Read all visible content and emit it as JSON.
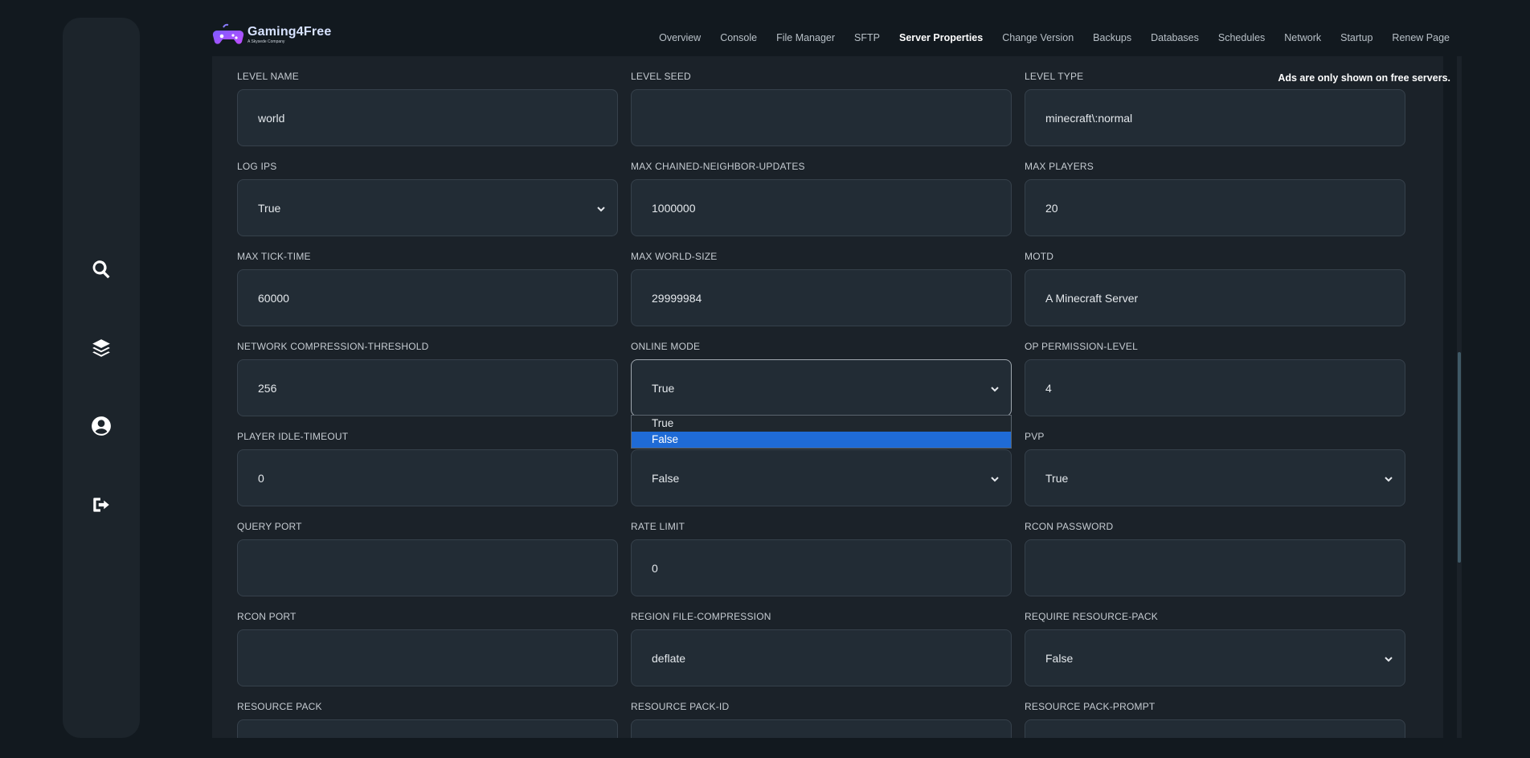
{
  "brand": {
    "name": "Gaming4Free",
    "tagline": "A Skysede Company"
  },
  "nav": [
    {
      "label": "Overview"
    },
    {
      "label": "Console"
    },
    {
      "label": "File Manager"
    },
    {
      "label": "SFTP"
    },
    {
      "label": "Server Properties",
      "active": true
    },
    {
      "label": "Change Version"
    },
    {
      "label": "Backups"
    },
    {
      "label": "Databases"
    },
    {
      "label": "Schedules"
    },
    {
      "label": "Network"
    },
    {
      "label": "Startup"
    },
    {
      "label": "Renew Page"
    }
  ],
  "ads_note": "Ads are only shown on free servers.",
  "sidebar_icons": [
    "search-icon",
    "layers-icon",
    "user-circle-icon",
    "logout-icon"
  ],
  "fields": [
    {
      "label": "LEVEL NAME",
      "value": "world",
      "type": "text"
    },
    {
      "label": "LEVEL SEED",
      "value": "",
      "type": "text"
    },
    {
      "label": "LEVEL TYPE",
      "value": "minecraft\\:normal",
      "type": "text"
    },
    {
      "label": "LOG IPS",
      "value": "True",
      "type": "select"
    },
    {
      "label": "MAX CHAINED-NEIGHBOR-UPDATES",
      "value": "1000000",
      "type": "text"
    },
    {
      "label": "MAX PLAYERS",
      "value": "20",
      "type": "text"
    },
    {
      "label": "MAX TICK-TIME",
      "value": "60000",
      "type": "text"
    },
    {
      "label": "MAX WORLD-SIZE",
      "value": "29999984",
      "type": "text"
    },
    {
      "label": "MOTD",
      "value": "A Minecraft Server",
      "type": "text"
    },
    {
      "label": "NETWORK COMPRESSION-THRESHOLD",
      "value": "256",
      "type": "text"
    },
    {
      "label": "ONLINE MODE",
      "value": "True",
      "type": "select",
      "focused": true
    },
    {
      "label": "OP PERMISSION-LEVEL",
      "value": "4",
      "type": "text"
    },
    {
      "label": "PLAYER IDLE-TIMEOUT",
      "value": "0",
      "type": "text"
    },
    {
      "label": "",
      "value": "False",
      "type": "select"
    },
    {
      "label": "PVP",
      "value": "True",
      "type": "select"
    },
    {
      "label": "QUERY PORT",
      "value": "",
      "type": "text"
    },
    {
      "label": "RATE LIMIT",
      "value": "0",
      "type": "text"
    },
    {
      "label": "RCON PASSWORD",
      "value": "",
      "type": "text"
    },
    {
      "label": "RCON PORT",
      "value": "",
      "type": "text"
    },
    {
      "label": "REGION FILE-COMPRESSION",
      "value": "deflate",
      "type": "text"
    },
    {
      "label": "REQUIRE RESOURCE-PACK",
      "value": "False",
      "type": "select"
    },
    {
      "label": "RESOURCE PACK",
      "value": "",
      "type": "text"
    },
    {
      "label": "RESOURCE PACK-ID",
      "value": "",
      "type": "text"
    },
    {
      "label": "RESOURCE PACK-PROMPT",
      "value": "",
      "type": "text"
    }
  ],
  "dropdown_options": [
    {
      "label": "True"
    },
    {
      "label": "False",
      "selected": true
    }
  ]
}
